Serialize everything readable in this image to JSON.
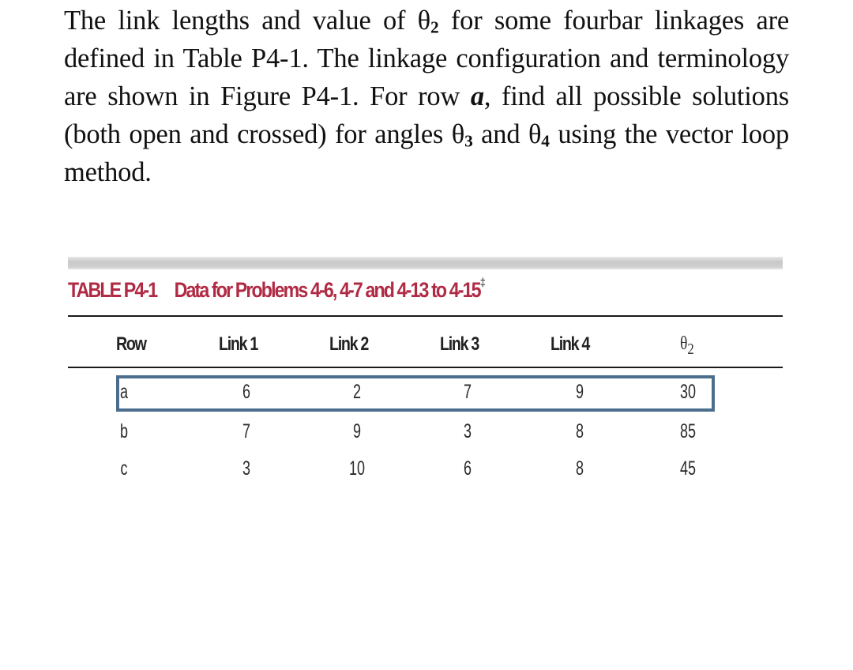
{
  "problem": {
    "segments": {
      "s1": "The link lengths and value of θ",
      "s1_sub": "2",
      "s2": " for some fourbar linkages are defined in Table P4-1. The linkage configuration and terminology are shown in Figure P4-1. For row ",
      "row_ref": "a",
      "s3": ", find all possible solutions (both open and crossed) for angles θ",
      "s3_sub": "3",
      "s4": " and θ",
      "s4_sub": "4",
      "s5": " using the vector loop method."
    }
  },
  "table": {
    "label": "TABLE  P4-1",
    "title": "Data for Problems 4-6, 4-7 and 4-13 to 4-15",
    "title_footnote_mark": "‡",
    "header_rule_color": "#1a1a1a",
    "title_color": "#b02a44",
    "highlight_color": "#4b6e8d",
    "columns": [
      {
        "key": "row",
        "label": "Row"
      },
      {
        "key": "link1",
        "label": "Link 1"
      },
      {
        "key": "link2",
        "label": "Link 2"
      },
      {
        "key": "link3",
        "label": "Link 3"
      },
      {
        "key": "link4",
        "label": "Link 4"
      },
      {
        "key": "theta2",
        "label": "θ",
        "label_sub": "2"
      }
    ],
    "rows": [
      {
        "row": "a",
        "link1": "6",
        "link2": "2",
        "link3": "7",
        "link4": "9",
        "theta2": "30",
        "highlighted": true
      },
      {
        "row": "b",
        "link1": "7",
        "link2": "9",
        "link3": "3",
        "link4": "8",
        "theta2": "85",
        "highlighted": false
      },
      {
        "row": "c",
        "link1": "3",
        "link2": "10",
        "link3": "6",
        "link4": "8",
        "theta2": "45",
        "highlighted": false
      }
    ]
  }
}
